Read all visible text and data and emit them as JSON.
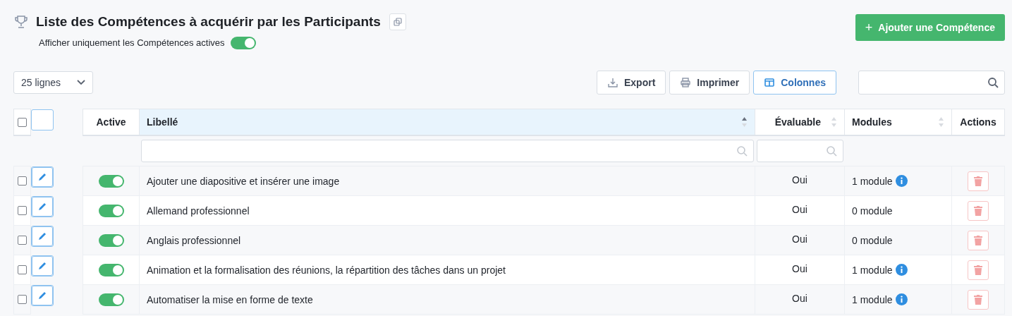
{
  "header": {
    "title": "Liste des Compétences à acquérir par les Participants",
    "filter_label": "Afficher uniquement les Compétences actives",
    "filter_on": true,
    "add_icon": "+",
    "add_button": "Ajouter une Compétence"
  },
  "toolbar": {
    "page_size": "25 lignes",
    "buttons": [
      {
        "kind": "export",
        "label": "Export",
        "selected": false
      },
      {
        "kind": "print",
        "label": "Imprimer",
        "selected": false
      },
      {
        "kind": "columns",
        "label": "Colonnes",
        "selected": true
      }
    ]
  },
  "table": {
    "select_all": false,
    "columns": [
      {
        "kind": "check"
      },
      {
        "kind": "edit"
      },
      {
        "kind": "active",
        "label": "Active"
      },
      {
        "kind": "label",
        "label": "Libellé",
        "sorted": true,
        "filter": true
      },
      {
        "kind": "evaluable",
        "label": "Évaluable",
        "sorted": false,
        "filter": true
      },
      {
        "kind": "modules",
        "label": "Modules",
        "sorted": false
      },
      {
        "kind": "actions",
        "label": "Actions"
      }
    ],
    "rows": [
      {
        "checked": false,
        "active": true,
        "label": "Ajouter une diapositive et insérer une image",
        "evaluable": "Oui",
        "modules": "1 module",
        "info": true
      },
      {
        "checked": false,
        "active": true,
        "label": "Allemand professionnel",
        "evaluable": "Oui",
        "modules": "0 module",
        "info": false
      },
      {
        "checked": false,
        "active": true,
        "label": "Anglais professionnel",
        "evaluable": "Oui",
        "modules": "0 module",
        "info": false
      },
      {
        "checked": false,
        "active": true,
        "label": "Animation et la formalisation des réunions, la répartition des tâches dans un projet",
        "evaluable": "Oui",
        "modules": "1 module",
        "info": true
      },
      {
        "checked": false,
        "active": true,
        "label": "Automatiser la mise en forme de texte",
        "evaluable": "Oui",
        "modules": "1 module",
        "info": true
      }
    ]
  }
}
